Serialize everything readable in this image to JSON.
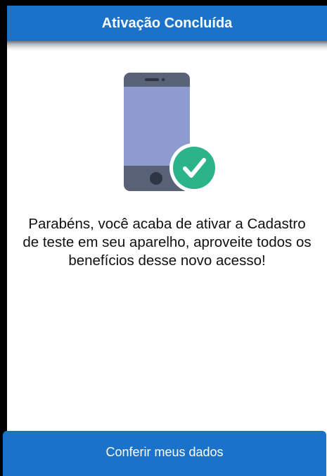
{
  "header": {
    "title": "Ativação Concluída"
  },
  "illustration": {
    "icon": "phone-check-icon",
    "colors": {
      "phone_body": "#5a6277",
      "phone_screen": "#8e9bcf",
      "check_badge": "#2bb38a"
    }
  },
  "message": {
    "text": "Parabéns, você acaba de ativar a Cadastro\nde teste em seu aparelho, aproveite todos os\nbenefícios desse novo acesso!"
  },
  "actions": {
    "primary_label": "Conferir meus dados"
  },
  "colors": {
    "accent": "#1a73c9"
  }
}
